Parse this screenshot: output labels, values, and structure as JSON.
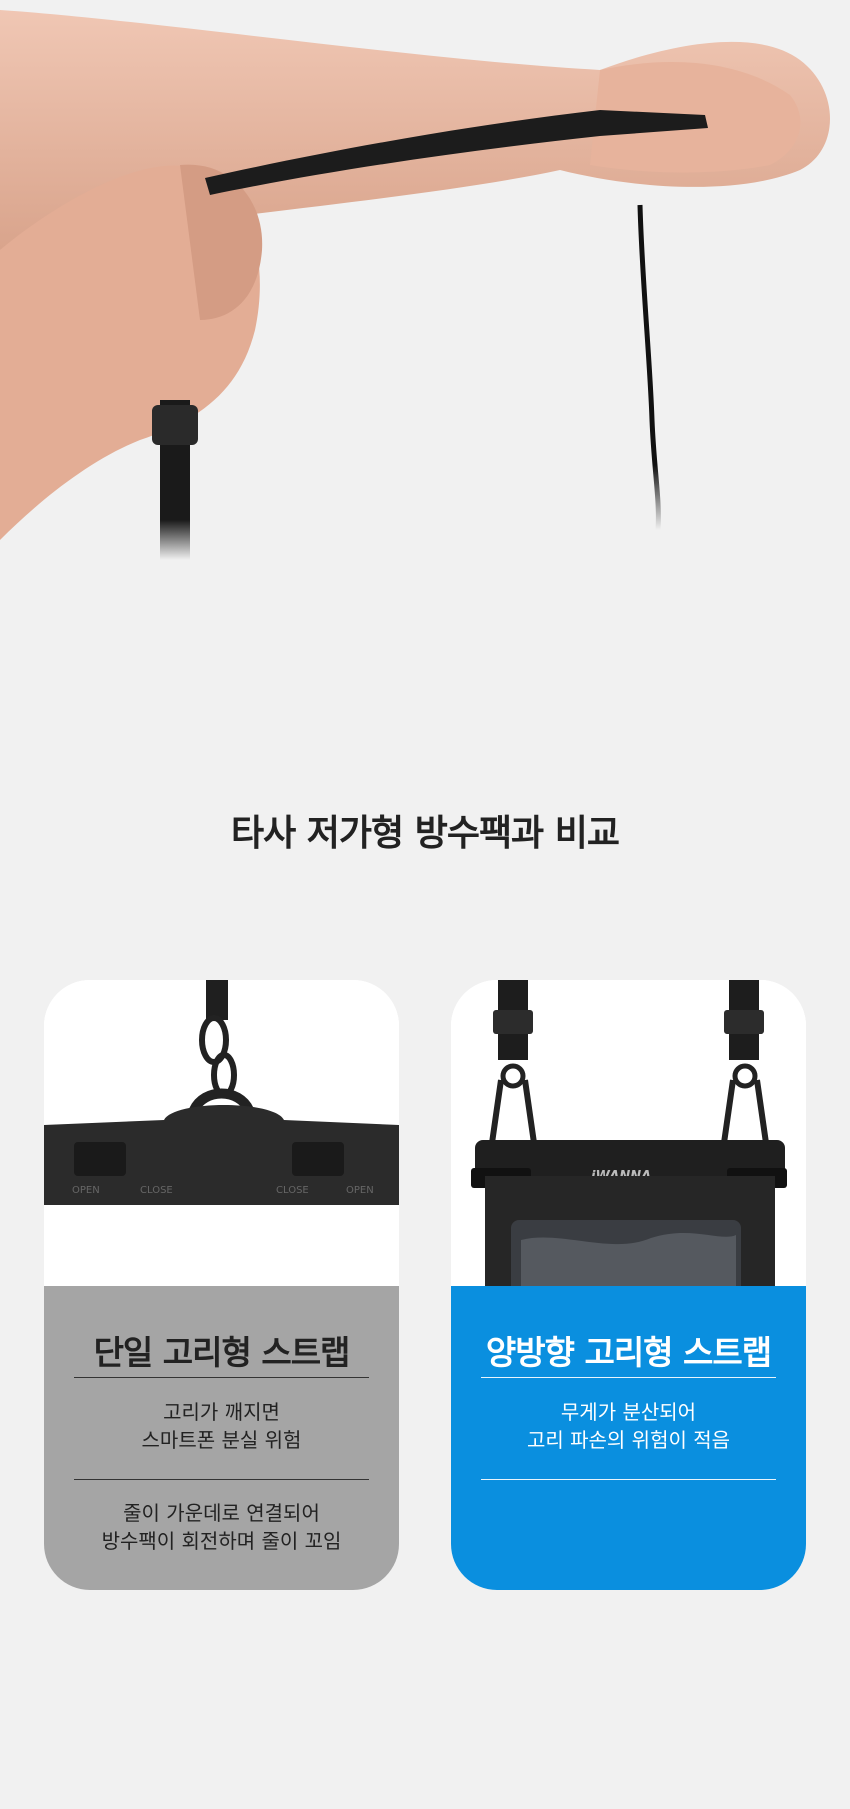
{
  "section": {
    "title": "타사 저가형 방수팩과 비교"
  },
  "cards": [
    {
      "title": "단일 고리형 스트랩",
      "notes": [
        [
          "고리가 깨지면",
          "스마트폰 분실 위험"
        ],
        [
          "줄이 가운데로 연결되어",
          "방수팩이 회전하며 줄이 꼬임"
        ]
      ],
      "photo_labels": {
        "open_left": "OPEN",
        "close_left": "CLOSE",
        "close_right": "CLOSE",
        "open_right": "OPEN"
      },
      "panel_color": "#a5a5a5"
    },
    {
      "title": "양방향 고리형 스트랩",
      "notes": [
        [
          "무게가 분산되어",
          "고리 파손의 위험이 적음"
        ]
      ],
      "brand_logo": "iWANNA",
      "panel_color": "#0a8fdf"
    }
  ],
  "colors": {
    "background": "#f1f1f1",
    "gray_panel": "#a5a5a5",
    "blue_panel": "#0a8fdf",
    "title_text": "#222222"
  }
}
